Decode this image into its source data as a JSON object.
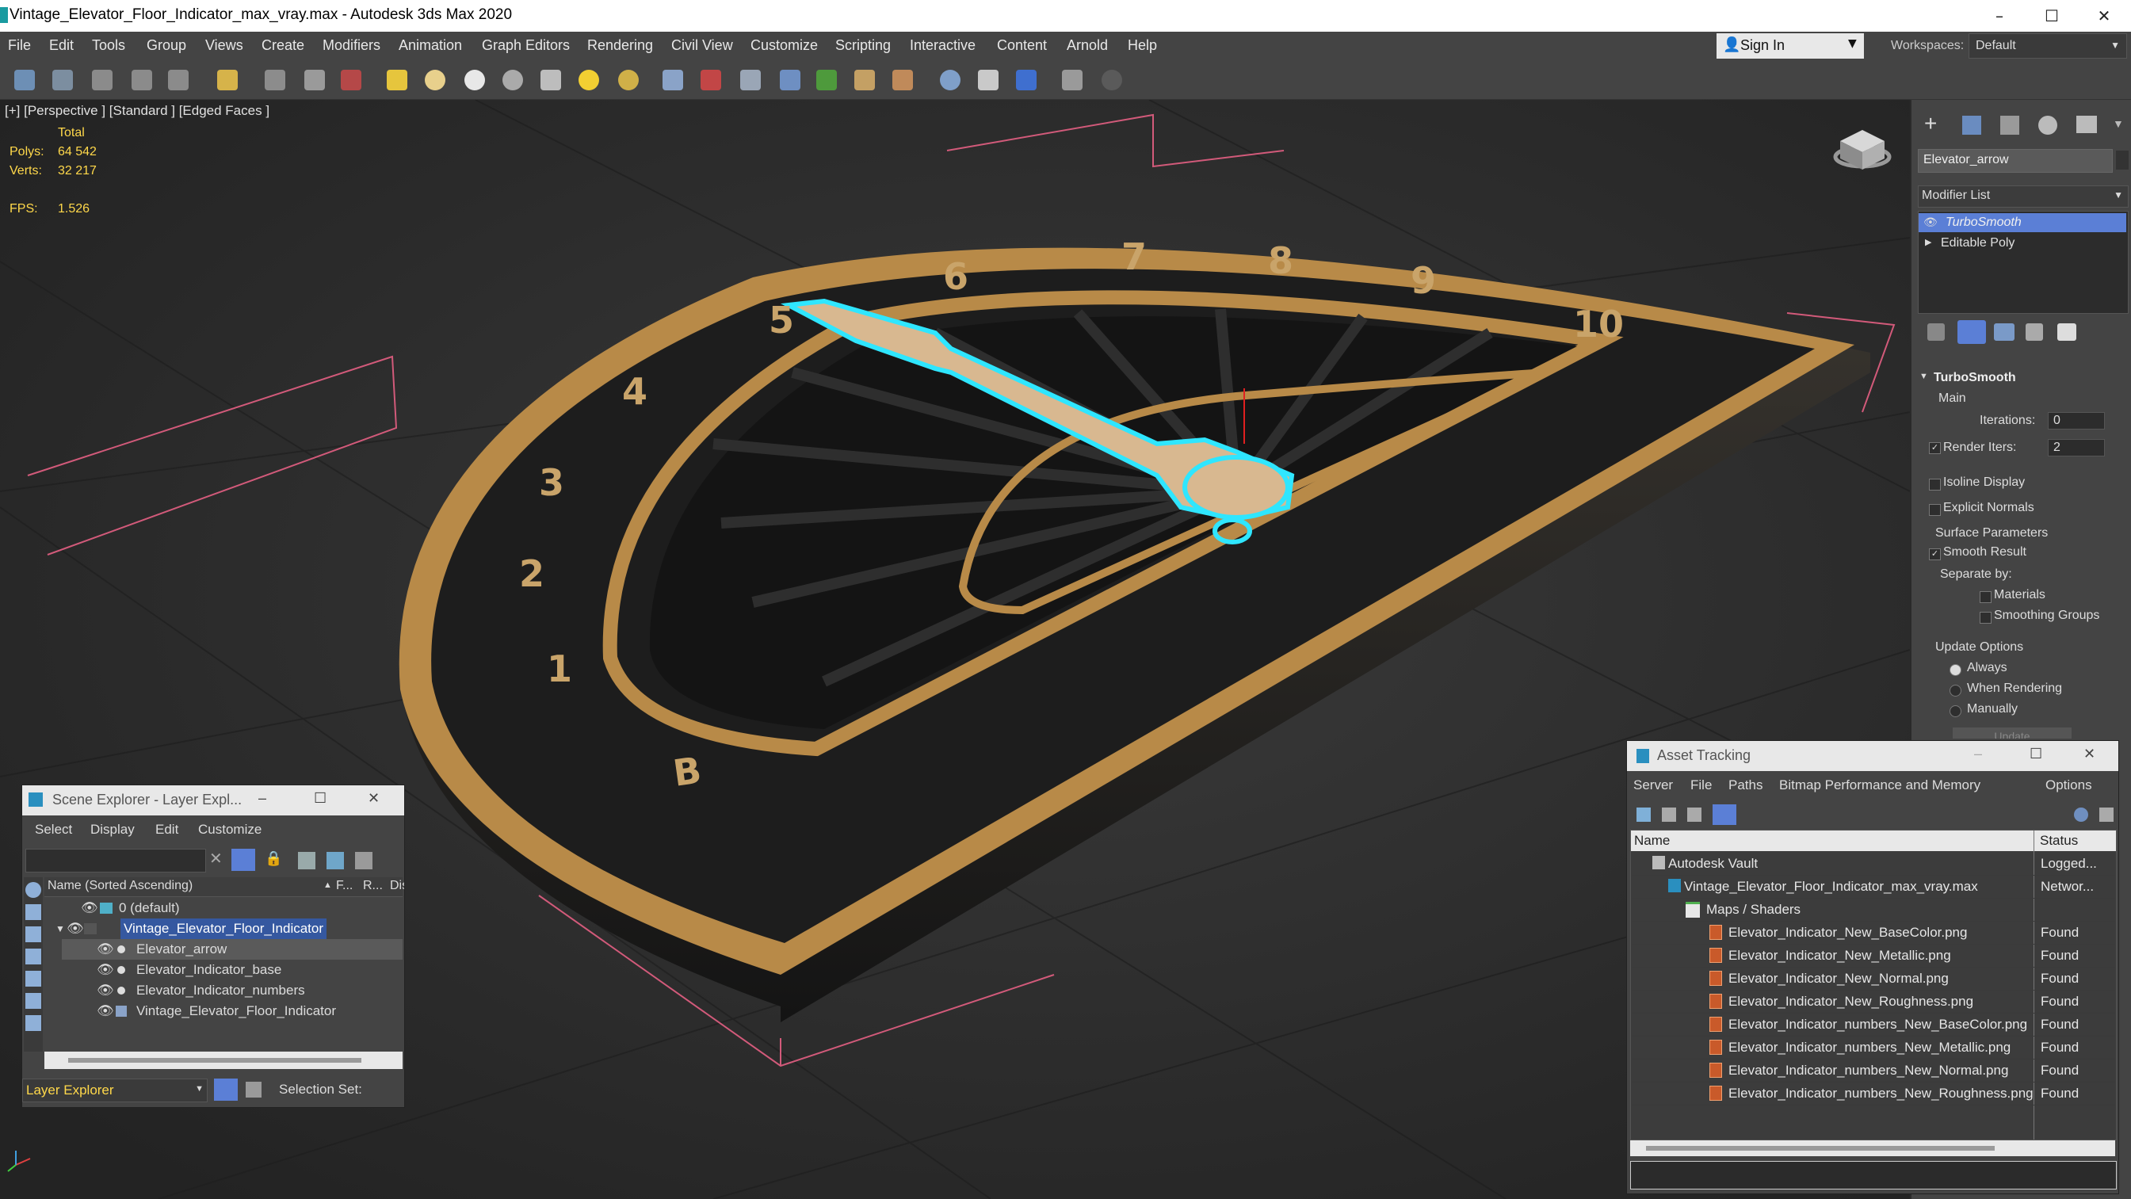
{
  "window": {
    "title": "Vintage_Elevator_Floor_Indicator_max_vray.max - Autodesk 3ds Max 2020",
    "controls": [
      "–",
      "☐",
      "✕"
    ]
  },
  "menu": [
    "File",
    "Edit",
    "Tools",
    "Group",
    "Views",
    "Create",
    "Modifiers",
    "Animation",
    "Graph Editors",
    "Rendering",
    "Civil View",
    "Customize",
    "Scripting",
    "Interactive",
    "Content",
    "Arnold",
    "Help"
  ],
  "account": {
    "signin": "Sign In",
    "workspaces_label": "Workspaces:",
    "workspace": "Default"
  },
  "viewport": {
    "label": "[+] [Perspective ] [Standard ] [Edged Faces ]",
    "stats": {
      "total_label": "Total",
      "polys_label": "Polys:",
      "polys": "64 542",
      "verts_label": "Verts:",
      "verts": "32 217",
      "fps_label": "FPS:",
      "fps": "1.526"
    },
    "dial_numbers": [
      "B",
      "1",
      "2",
      "3",
      "4",
      "5",
      "6",
      "7",
      "8",
      "9",
      "10"
    ]
  },
  "command_panel": {
    "object_name": "Elevator_arrow",
    "modifier_list": "Modifier List",
    "stack": [
      "TurboSmooth",
      "Editable Poly"
    ],
    "rollout_title": "TurboSmooth",
    "main_label": "Main",
    "iterations_label": "Iterations:",
    "iterations": "0",
    "render_iters_label": "Render Iters:",
    "render_iters": "2",
    "isoline": "Isoline Display",
    "explicit_normals": "Explicit Normals",
    "surface_params": "Surface Parameters",
    "smooth_result": "Smooth Result",
    "separate_by": "Separate by:",
    "materials": "Materials",
    "smoothing_groups": "Smoothing Groups",
    "update_options": "Update Options",
    "always": "Always",
    "when_rendering": "When Rendering",
    "manually": "Manually",
    "update": "Update"
  },
  "scene_explorer": {
    "title": "Scene Explorer - Layer Expl...",
    "menu": [
      "Select",
      "Display",
      "Edit",
      "Customize"
    ],
    "columns": {
      "name": "Name (Sorted Ascending)",
      "f": "F...",
      "r": "R...",
      "display": "Displa"
    },
    "rows": [
      {
        "name": "0 (default)",
        "indent": 0
      },
      {
        "name": "Vintage_Elevator_Floor_Indicator",
        "indent": 0
      },
      {
        "name": "Elevator_arrow",
        "indent": 1
      },
      {
        "name": "Elevator_Indicator_base",
        "indent": 1
      },
      {
        "name": "Elevator_Indicator_numbers",
        "indent": 1
      },
      {
        "name": "Vintage_Elevator_Floor_Indicator",
        "indent": 1
      }
    ],
    "footer_dropdown": "Layer Explorer",
    "selection_set": "Selection Set:"
  },
  "asset_tracking": {
    "title": "Asset Tracking",
    "menu": [
      "Server",
      "File",
      "Paths",
      "Bitmap Performance and Memory",
      "Options"
    ],
    "col_name": "Name",
    "col_status": "Status",
    "rows": [
      {
        "name": "Autodesk Vault",
        "status": "Logged...",
        "indent": 0
      },
      {
        "name": "Vintage_Elevator_Floor_Indicator_max_vray.max",
        "status": "Networ...",
        "indent": 1
      },
      {
        "name": "Maps / Shaders",
        "status": "",
        "indent": 2
      },
      {
        "name": "Elevator_Indicator_New_BaseColor.png",
        "status": "Found",
        "indent": 3
      },
      {
        "name": "Elevator_Indicator_New_Metallic.png",
        "status": "Found",
        "indent": 3
      },
      {
        "name": "Elevator_Indicator_New_Normal.png",
        "status": "Found",
        "indent": 3
      },
      {
        "name": "Elevator_Indicator_New_Roughness.png",
        "status": "Found",
        "indent": 3
      },
      {
        "name": "Elevator_Indicator_numbers_New_BaseColor.png",
        "status": "Found",
        "indent": 3
      },
      {
        "name": "Elevator_Indicator_numbers_New_Metallic.png",
        "status": "Found",
        "indent": 3
      },
      {
        "name": "Elevator_Indicator_numbers_New_Normal.png",
        "status": "Found",
        "indent": 3
      },
      {
        "name": "Elevator_Indicator_numbers_New_Roughness.png",
        "status": "Found",
        "indent": 3
      }
    ]
  },
  "colors": {
    "viewport_bg": "#2b2b2b",
    "selection_outline": "#2fe6ff",
    "gold_trim": "#b88a48",
    "panel_bg": "#444444",
    "stat_text": "#ffd84a",
    "highlight": "#5b7fd6"
  }
}
